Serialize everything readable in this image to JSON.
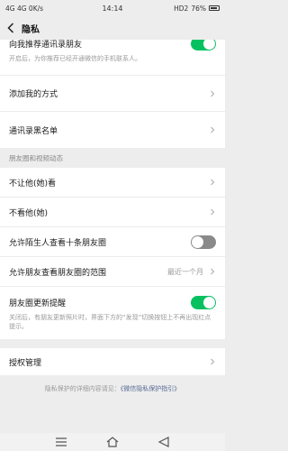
{
  "status_bar": {
    "left_text": "4G  4G  0K/s",
    "time": "14:14",
    "right_text": "HD2",
    "battery": "76%"
  },
  "nav": {
    "title": "隐私"
  },
  "top_section": {
    "recommend_label": "向我推荐通讯录朋友",
    "recommend_desc": "开启后，为你推荐已经开通微信的手机联系人。",
    "add_me_label": "添加我的方式",
    "blacklist_label": "通讯录黑名单"
  },
  "moments_section": {
    "header": "朋友圈和视频动态",
    "hide_from_label": "不让他(她)看",
    "dont_see_label": "不看他(她)",
    "stranger_label": "允许陌生人查看十条朋友圈",
    "range_label": "允许朋友查看朋友圈的范围",
    "range_value": "最近一个月",
    "update_label": "朋友圈更新提醒",
    "update_desc": "关闭后，有朋友更新照片时，界面下方的“发现”切换按钮上不再出现红点提示。"
  },
  "auth_section": {
    "label": "授权管理"
  },
  "footer": {
    "prefix": "隐私保护的详细内容请见：",
    "link": "《微信隐私保护指引》"
  },
  "toggles": {
    "recommend": true,
    "stranger": false,
    "update": true
  },
  "colors": {
    "accent": "#07c160",
    "link": "#576b95"
  }
}
